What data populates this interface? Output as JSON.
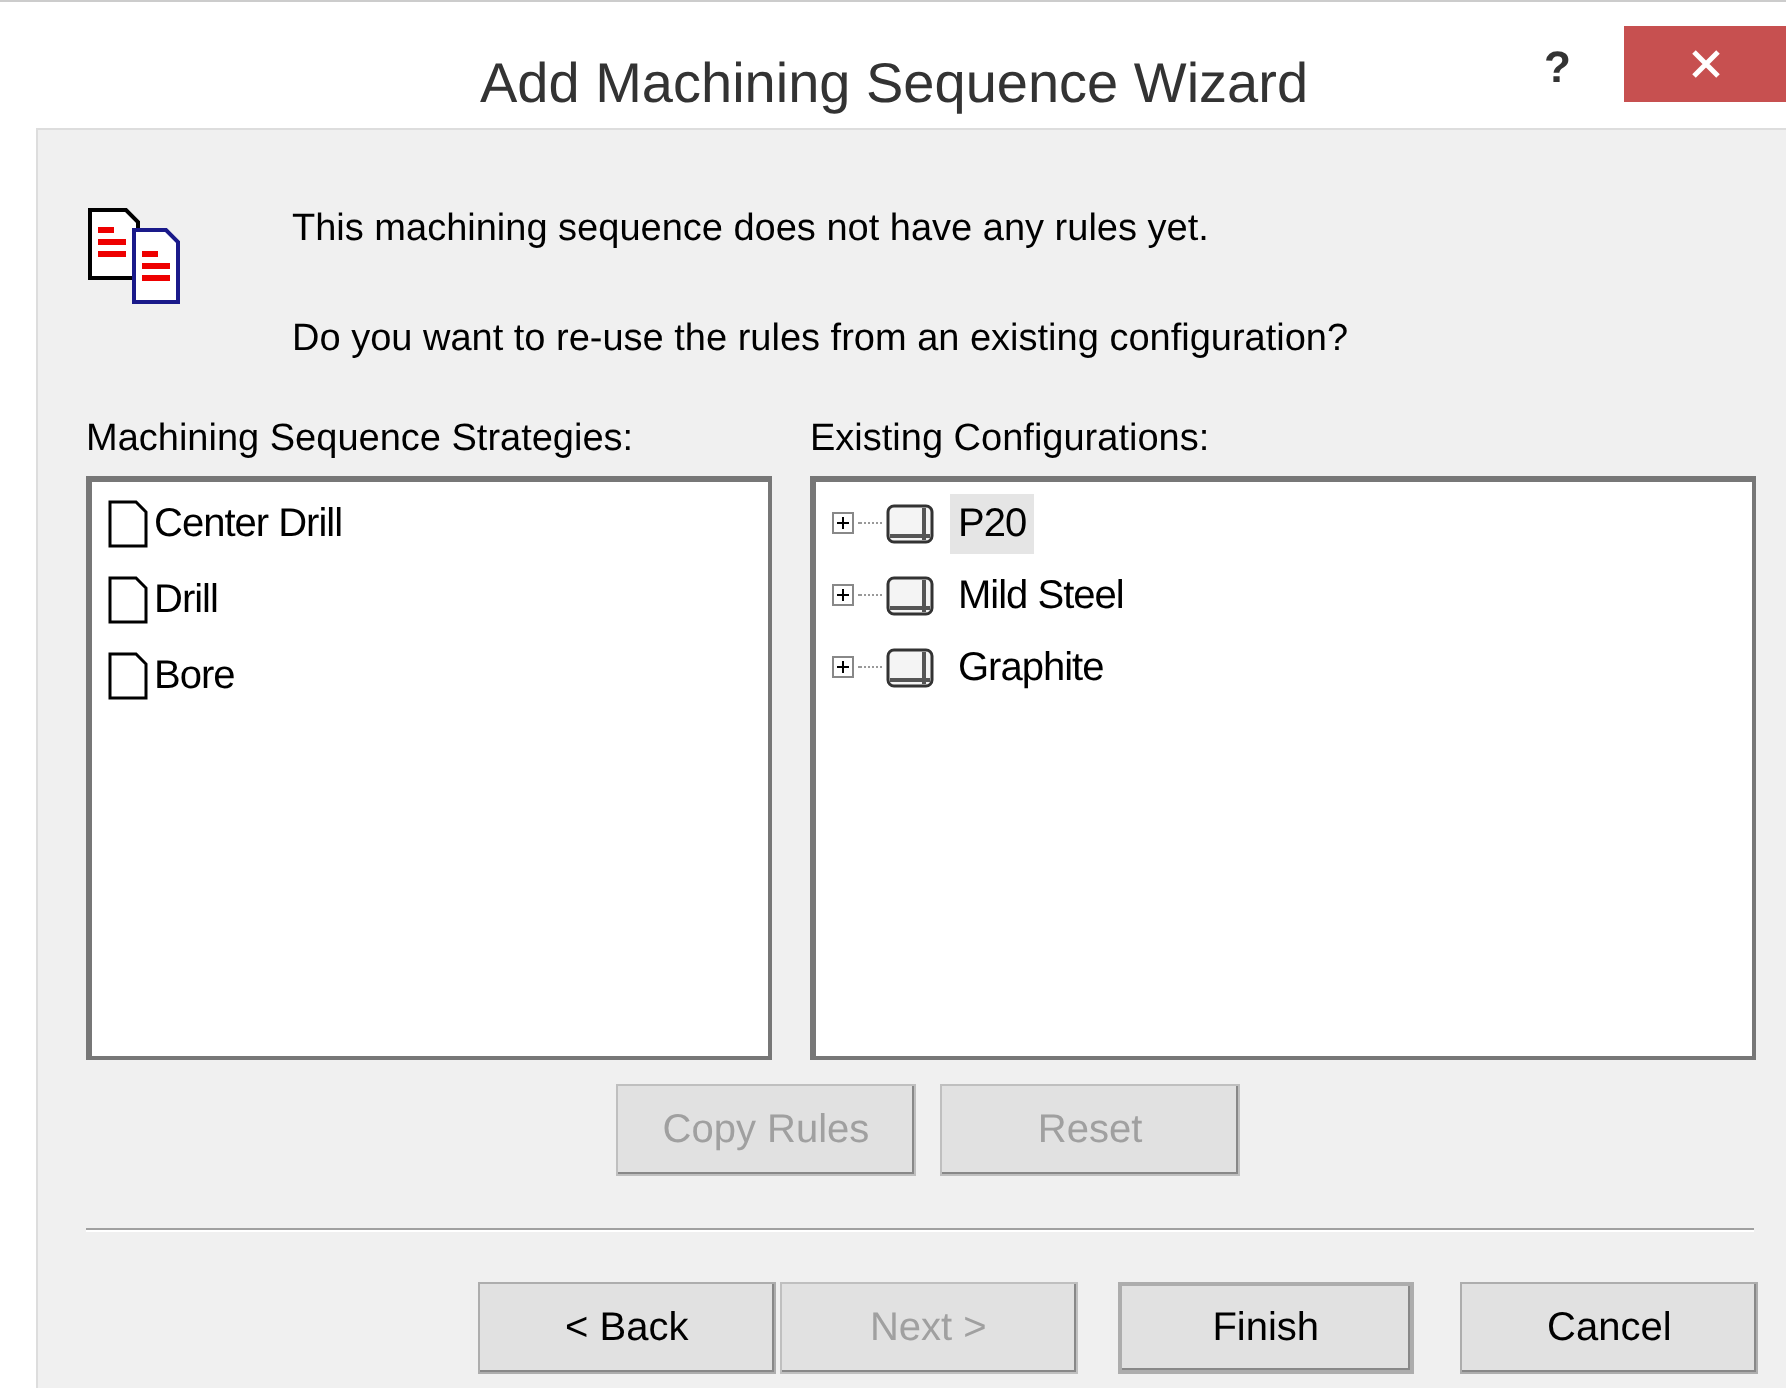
{
  "window": {
    "title": "Add Machining Sequence Wizard",
    "help_button": "?"
  },
  "messages": [
    "This machining sequence does not have any rules yet.",
    "Do you want to re-use the rules from an existing configuration?"
  ],
  "strategies": {
    "label": "Machining Sequence Strategies:",
    "items": [
      {
        "label": "Center Drill"
      },
      {
        "label": "Drill"
      },
      {
        "label": "Bore"
      }
    ]
  },
  "configurations": {
    "label": "Existing Configurations:",
    "items": [
      {
        "label": "P20",
        "selected": true,
        "expanded": false
      },
      {
        "label": "Mild Steel",
        "selected": false,
        "expanded": false
      },
      {
        "label": "Graphite",
        "selected": false,
        "expanded": false
      }
    ]
  },
  "rule_buttons": [
    {
      "label": "Copy Rules",
      "disabled": true
    },
    {
      "label": "Reset",
      "disabled": true
    }
  ],
  "nav_buttons": [
    {
      "label": "< Back",
      "disabled": false,
      "default": false
    },
    {
      "label": "Next >",
      "disabled": true,
      "default": false
    },
    {
      "label": "Finish",
      "disabled": false,
      "default": true
    },
    {
      "label": "Cancel",
      "disabled": false,
      "default": false
    }
  ]
}
